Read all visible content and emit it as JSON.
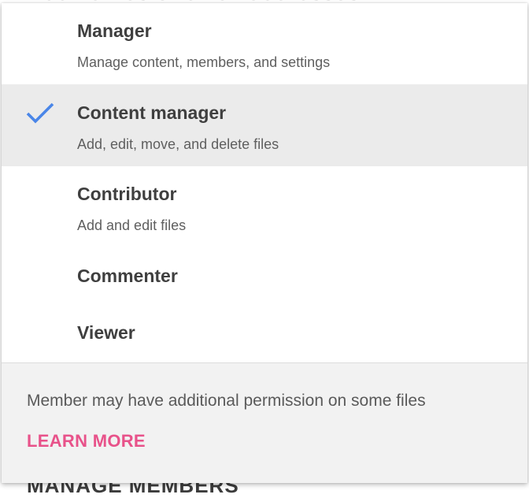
{
  "background": {
    "input_placeholder": "Add names or email addresses",
    "section_label": "MANAGE MEMBERS"
  },
  "menu": {
    "options": [
      {
        "title": "Manager",
        "description": "Manage content, members, and settings",
        "selected": false
      },
      {
        "title": "Content manager",
        "description": "Add, edit, move, and delete files",
        "selected": true
      },
      {
        "title": "Contributor",
        "description": "Add and edit files",
        "selected": false
      },
      {
        "title": "Commenter",
        "description": "",
        "selected": false
      },
      {
        "title": "Viewer",
        "description": "",
        "selected": false
      }
    ],
    "selected_icon": "checkmark-icon",
    "footer": {
      "note": "Member may have additional permission on some files",
      "link": "LEARN MORE"
    }
  },
  "colors": {
    "selected_background": "#ebebeb",
    "checkmark": "#4a86e8",
    "link": "#e8528a",
    "footer_background": "#f2f2f2"
  }
}
